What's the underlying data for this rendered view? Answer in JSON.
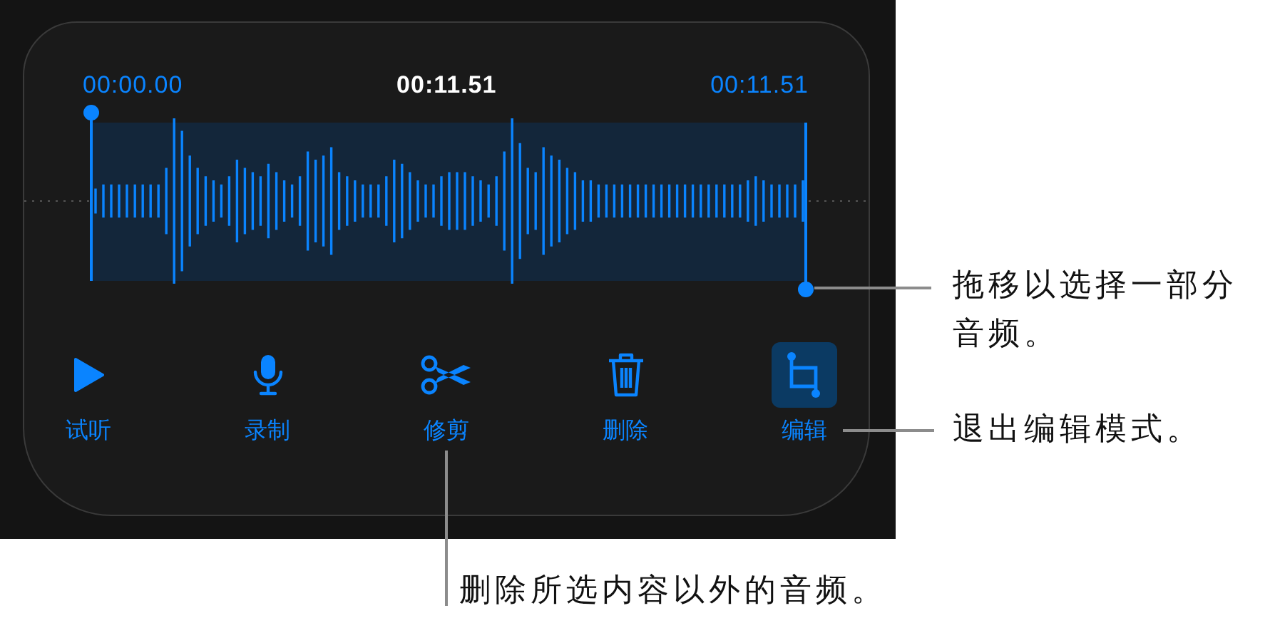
{
  "times": {
    "start": "00:00.00",
    "current": "00:11.51",
    "end": "00:11.51"
  },
  "toolbar": [
    {
      "label": "试听",
      "selected": false
    },
    {
      "label": "录制",
      "selected": false
    },
    {
      "label": "修剪",
      "selected": false
    },
    {
      "label": "删除",
      "selected": false
    },
    {
      "label": "编辑",
      "selected": true
    }
  ],
  "callouts": [
    {
      "text": "拖移以选择一部分音频。"
    },
    {
      "text": "退出编辑模式。"
    },
    {
      "text": "删除所选内容以外的音频。"
    }
  ]
}
